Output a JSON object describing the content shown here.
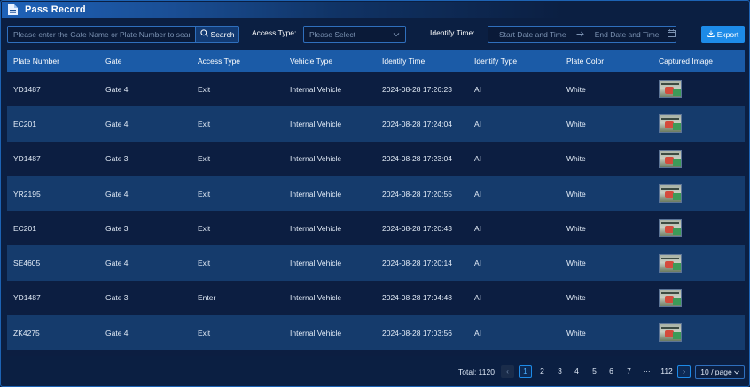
{
  "title": "Pass Record",
  "toolbar": {
    "search_placeholder": "Please enter the Gate Name or Plate Number to search",
    "search_label": "Search",
    "access_type_label": "Access Type:",
    "access_type_placeholder": "Please Select",
    "identify_time_label": "Identify Time:",
    "start_placeholder": "Start Date and Time",
    "end_placeholder": "End Date and Time",
    "export_label": "Export"
  },
  "table": {
    "columns": [
      "Plate Number",
      "Gate",
      "Access Type",
      "Vehicle Type",
      "Identify Time",
      "Identify Type",
      "Plate Color",
      "Captured Image"
    ],
    "rows": [
      [
        "YD1487",
        "Gate 4",
        "Exit",
        "Internal Vehicle",
        "2024-08-28 17:26:23",
        "AI",
        "White"
      ],
      [
        "EC201",
        "Gate 4",
        "Exit",
        "Internal Vehicle",
        "2024-08-28 17:24:04",
        "AI",
        "White"
      ],
      [
        "YD1487",
        "Gate 3",
        "Exit",
        "Internal Vehicle",
        "2024-08-28 17:23:04",
        "AI",
        "White"
      ],
      [
        "YR2195",
        "Gate 4",
        "Exit",
        "Internal Vehicle",
        "2024-08-28 17:20:55",
        "AI",
        "White"
      ],
      [
        "EC201",
        "Gate 3",
        "Exit",
        "Internal Vehicle",
        "2024-08-28 17:20:43",
        "AI",
        "White"
      ],
      [
        "SE4605",
        "Gate 4",
        "Exit",
        "Internal Vehicle",
        "2024-08-28 17:20:14",
        "AI",
        "White"
      ],
      [
        "YD1487",
        "Gate 3",
        "Enter",
        "Internal Vehicle",
        "2024-08-28 17:04:48",
        "AI",
        "White"
      ],
      [
        "ZK4275",
        "Gate 4",
        "Exit",
        "Internal Vehicle",
        "2024-08-28 17:03:56",
        "AI",
        "White"
      ]
    ]
  },
  "pagination": {
    "total_label": "Total: 1120",
    "pages": [
      "1",
      "2",
      "3",
      "4",
      "5",
      "6",
      "7",
      "···",
      "112"
    ],
    "current_page": "1",
    "page_size_label": "10 / page"
  },
  "colors": {
    "background": "#0b1f42",
    "header_row": "#1b5ba7",
    "accent": "#1d8be8"
  }
}
